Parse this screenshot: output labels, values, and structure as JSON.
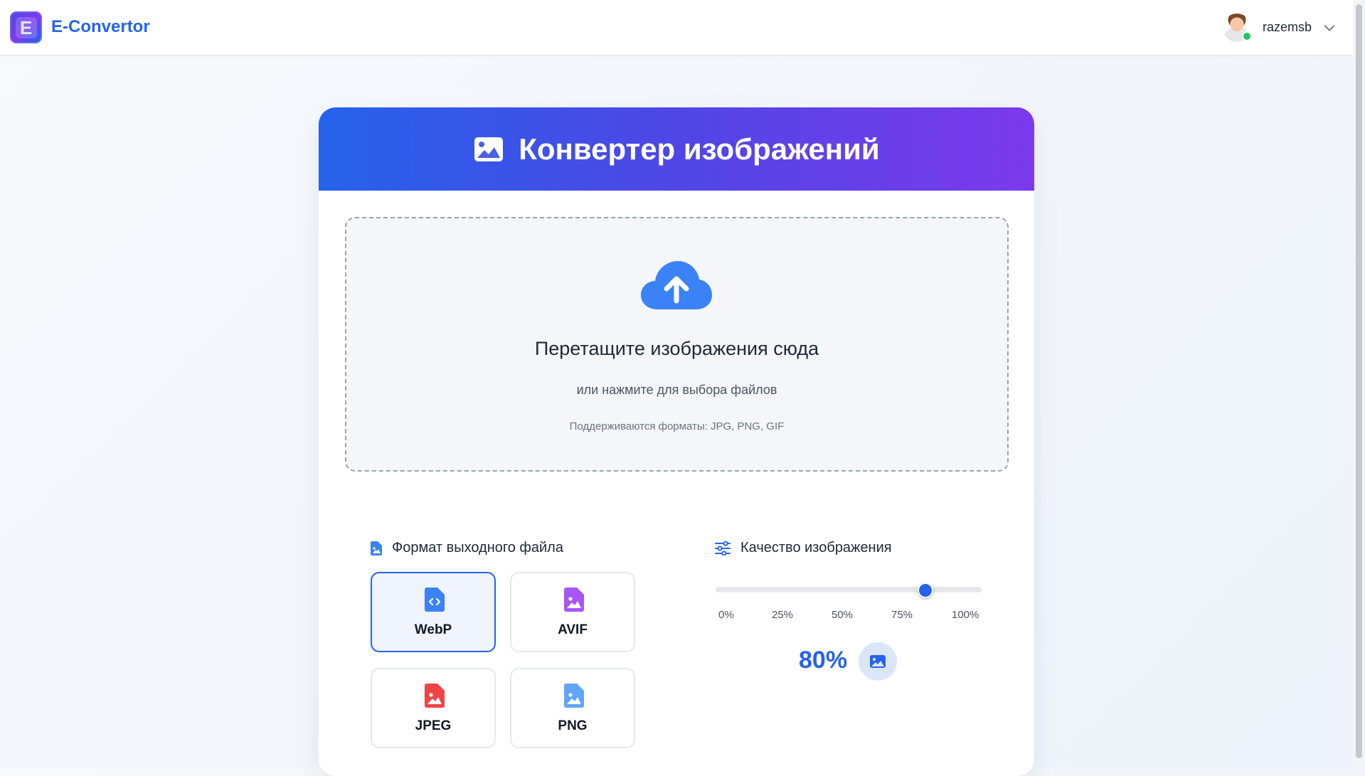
{
  "header": {
    "brand": "E-Convertor",
    "logo_letter": "E",
    "username": "razemsb"
  },
  "card": {
    "title": "Конвертер изображений"
  },
  "dropzone": {
    "title": "Перетащите изображения сюда",
    "subtitle": "или нажмите для выбора файлов",
    "formats": "Поддерживаются форматы: JPG, PNG, GIF"
  },
  "format_section": {
    "title": "Формат выходного файла",
    "options": [
      {
        "label": "WebP",
        "icon": "file-code-icon",
        "color": "#3b82f6",
        "selected": true
      },
      {
        "label": "AVIF",
        "icon": "file-image-icon",
        "color": "#a855f7",
        "selected": false
      },
      {
        "label": "JPEG",
        "icon": "file-image-icon",
        "color": "#ef4444",
        "selected": false
      },
      {
        "label": "PNG",
        "icon": "file-image-icon",
        "color": "#60a5fa",
        "selected": false
      }
    ]
  },
  "quality_section": {
    "title": "Качество изображения",
    "ticks": [
      "0%",
      "25%",
      "50%",
      "75%",
      "100%"
    ],
    "value": 80,
    "value_label": "80%"
  },
  "colors": {
    "accent": "#2563eb",
    "header_gradient_start": "#2563eb",
    "header_gradient_end": "#7c3aed",
    "online": "#22c55e"
  }
}
